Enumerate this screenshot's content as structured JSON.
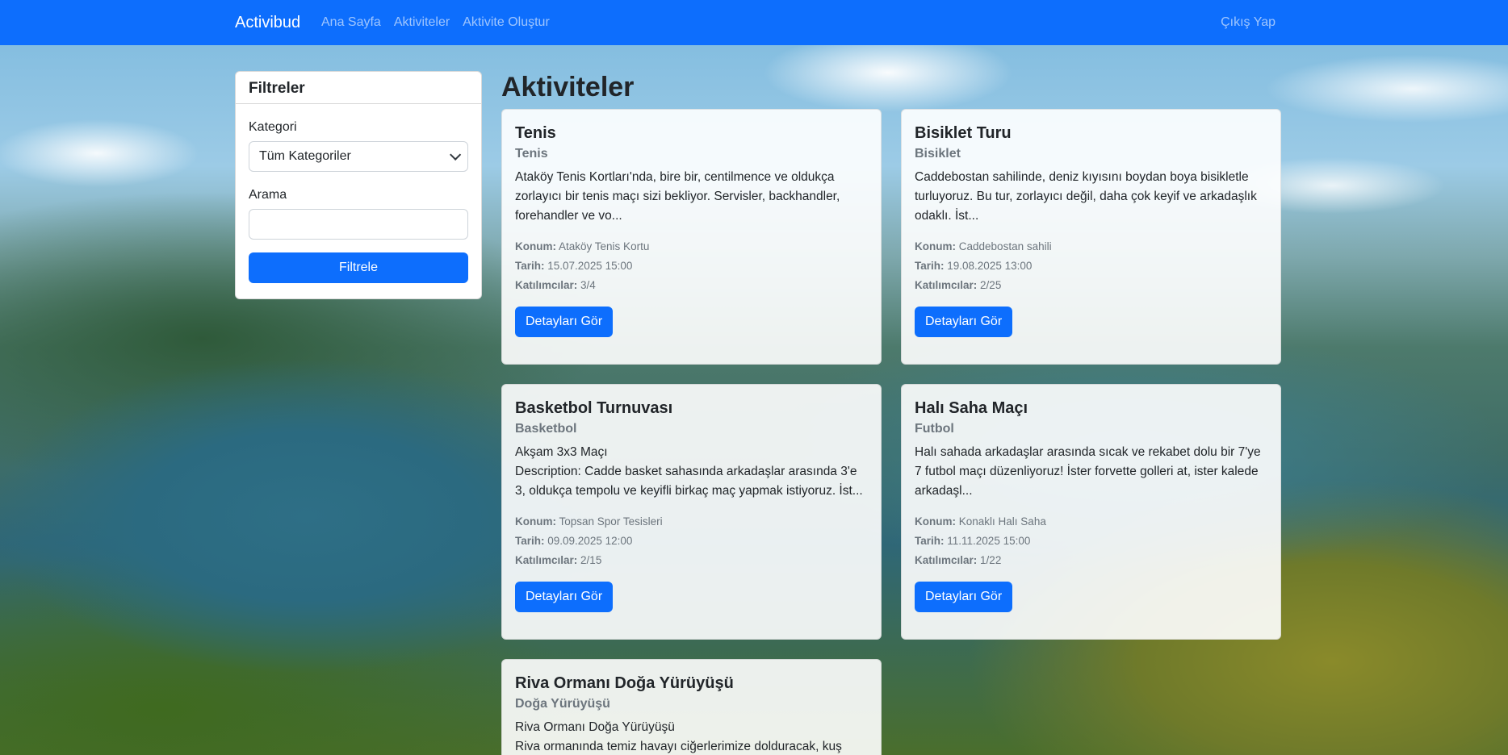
{
  "nav": {
    "brand": "Activibud",
    "links": [
      "Ana Sayfa",
      "Aktiviteler",
      "Aktivite Oluştur"
    ],
    "logout": "Çıkış Yap"
  },
  "filters": {
    "header": "Filtreler",
    "category_label": "Kategori",
    "category_selected": "Tüm Kategoriler",
    "search_label": "Arama",
    "search_value": "",
    "submit": "Filtrele"
  },
  "page_title": "Aktiviteler",
  "meta_labels": {
    "location": "Konum:",
    "date": "Tarih:",
    "participants": "Katılımcılar:"
  },
  "detail_button": "Detayları Gör",
  "activities": [
    {
      "title": "Tenis",
      "category": "Tenis",
      "description": "Ataköy Tenis Kortları'nda, bire bir, centilmence ve oldukça zorlayıcı bir tenis maçı sizi bekliyor. Servisler, backhandler, forehandler ve vo...",
      "location": "Ataköy Tenis Kortu",
      "date": "15.07.2025 15:00",
      "participants": "3/4"
    },
    {
      "title": "Bisiklet Turu",
      "category": "Bisiklet",
      "description": "Caddebostan sahilinde, deniz kıyısını boydan boya bisikletle turluyoruz. Bu tur, zorlayıcı değil, daha çok keyif ve arkadaşlık odaklı. İst...",
      "location": "Caddebostan sahili",
      "date": "19.08.2025 13:00",
      "participants": "2/25"
    },
    {
      "title": "Basketbol Turnuvası",
      "category": "Basketbol",
      "description": "Akşam 3x3 Maçı\nDescription: Cadde basket sahasında arkadaşlar arasında 3'e 3, oldukça tempolu ve keyifli birkaç maç yapmak istiyoruz. İst...",
      "location": "Topsan Spor Tesisleri",
      "date": "09.09.2025 12:00",
      "participants": "2/15"
    },
    {
      "title": "Halı Saha Maçı",
      "category": "Futbol",
      "description": "Halı sahada arkadaşlar arasında sıcak ve rekabet dolu bir 7'ye 7 futbol maçı düzenliyoruz! İster forvette golleri at, ister kalede arkadaşl...",
      "location": "Konaklı Halı Saha",
      "date": "11.11.2025 15:00",
      "participants": "1/22"
    },
    {
      "title": "Riva Ormanı Doğa Yürüyüşü",
      "category": "Doğa Yürüyüşü",
      "description": "Riva Ormanı Doğa Yürüyüşü\nRiva ormanında temiz havayı ciğerlerimize dolduracak, kuş",
      "location": "",
      "date": "",
      "participants": ""
    }
  ],
  "colors": {
    "primary": "#0d6efd",
    "muted": "#6c757d",
    "text": "#212529"
  }
}
